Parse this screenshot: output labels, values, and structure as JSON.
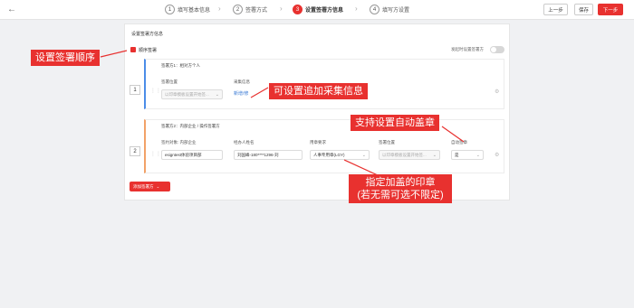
{
  "topbar": {
    "back_icon": "arrow-left",
    "steps": [
      {
        "num": "1",
        "label": "填写基本信息"
      },
      {
        "num": "2",
        "label": "签署方式"
      },
      {
        "num": "3",
        "label": "设置签署方信息"
      },
      {
        "num": "4",
        "label": "填写方设置"
      }
    ],
    "active_step": 2,
    "buttons": {
      "prev": "上一步",
      "save": "保存",
      "next": "下一步"
    },
    "accent_color": "#e8312f"
  },
  "section": {
    "title": "设置签署方信息",
    "sequential_sign_label": "顺序签署",
    "toggle_label": "发起时设置签署方"
  },
  "signers": [
    {
      "index": "1",
      "title": "签署方1：相对方个人",
      "position_label": "签署位置",
      "position_placeholder": "以印章模板设置开始签...",
      "collect_label": "采集信息",
      "add_link": "新增/修"
    },
    {
      "index": "2",
      "title": "签署方2：内部企业 / 操作签署方",
      "signer_label": "签约对象: 内部企业",
      "signer_value": "esigntest体验项目部",
      "handler_label": "经办人姓名",
      "handler_value": "刘国峰-180****1296-刘",
      "seal_label": "用章要求",
      "seal_value": "人事专用章(LGY)",
      "position_label": "签署位置",
      "position_placeholder": "以印章模板设置开始签...",
      "auto_label": "自动签章",
      "auto_value": "是"
    }
  ],
  "add_signer_button": "添加签署方",
  "annotations": {
    "order": "设置签署顺序",
    "collect": "可设置追加采集信息",
    "auto": "支持设置自动盖章",
    "seal": "指定加盖的印章\n(若无需可选不限定)"
  }
}
